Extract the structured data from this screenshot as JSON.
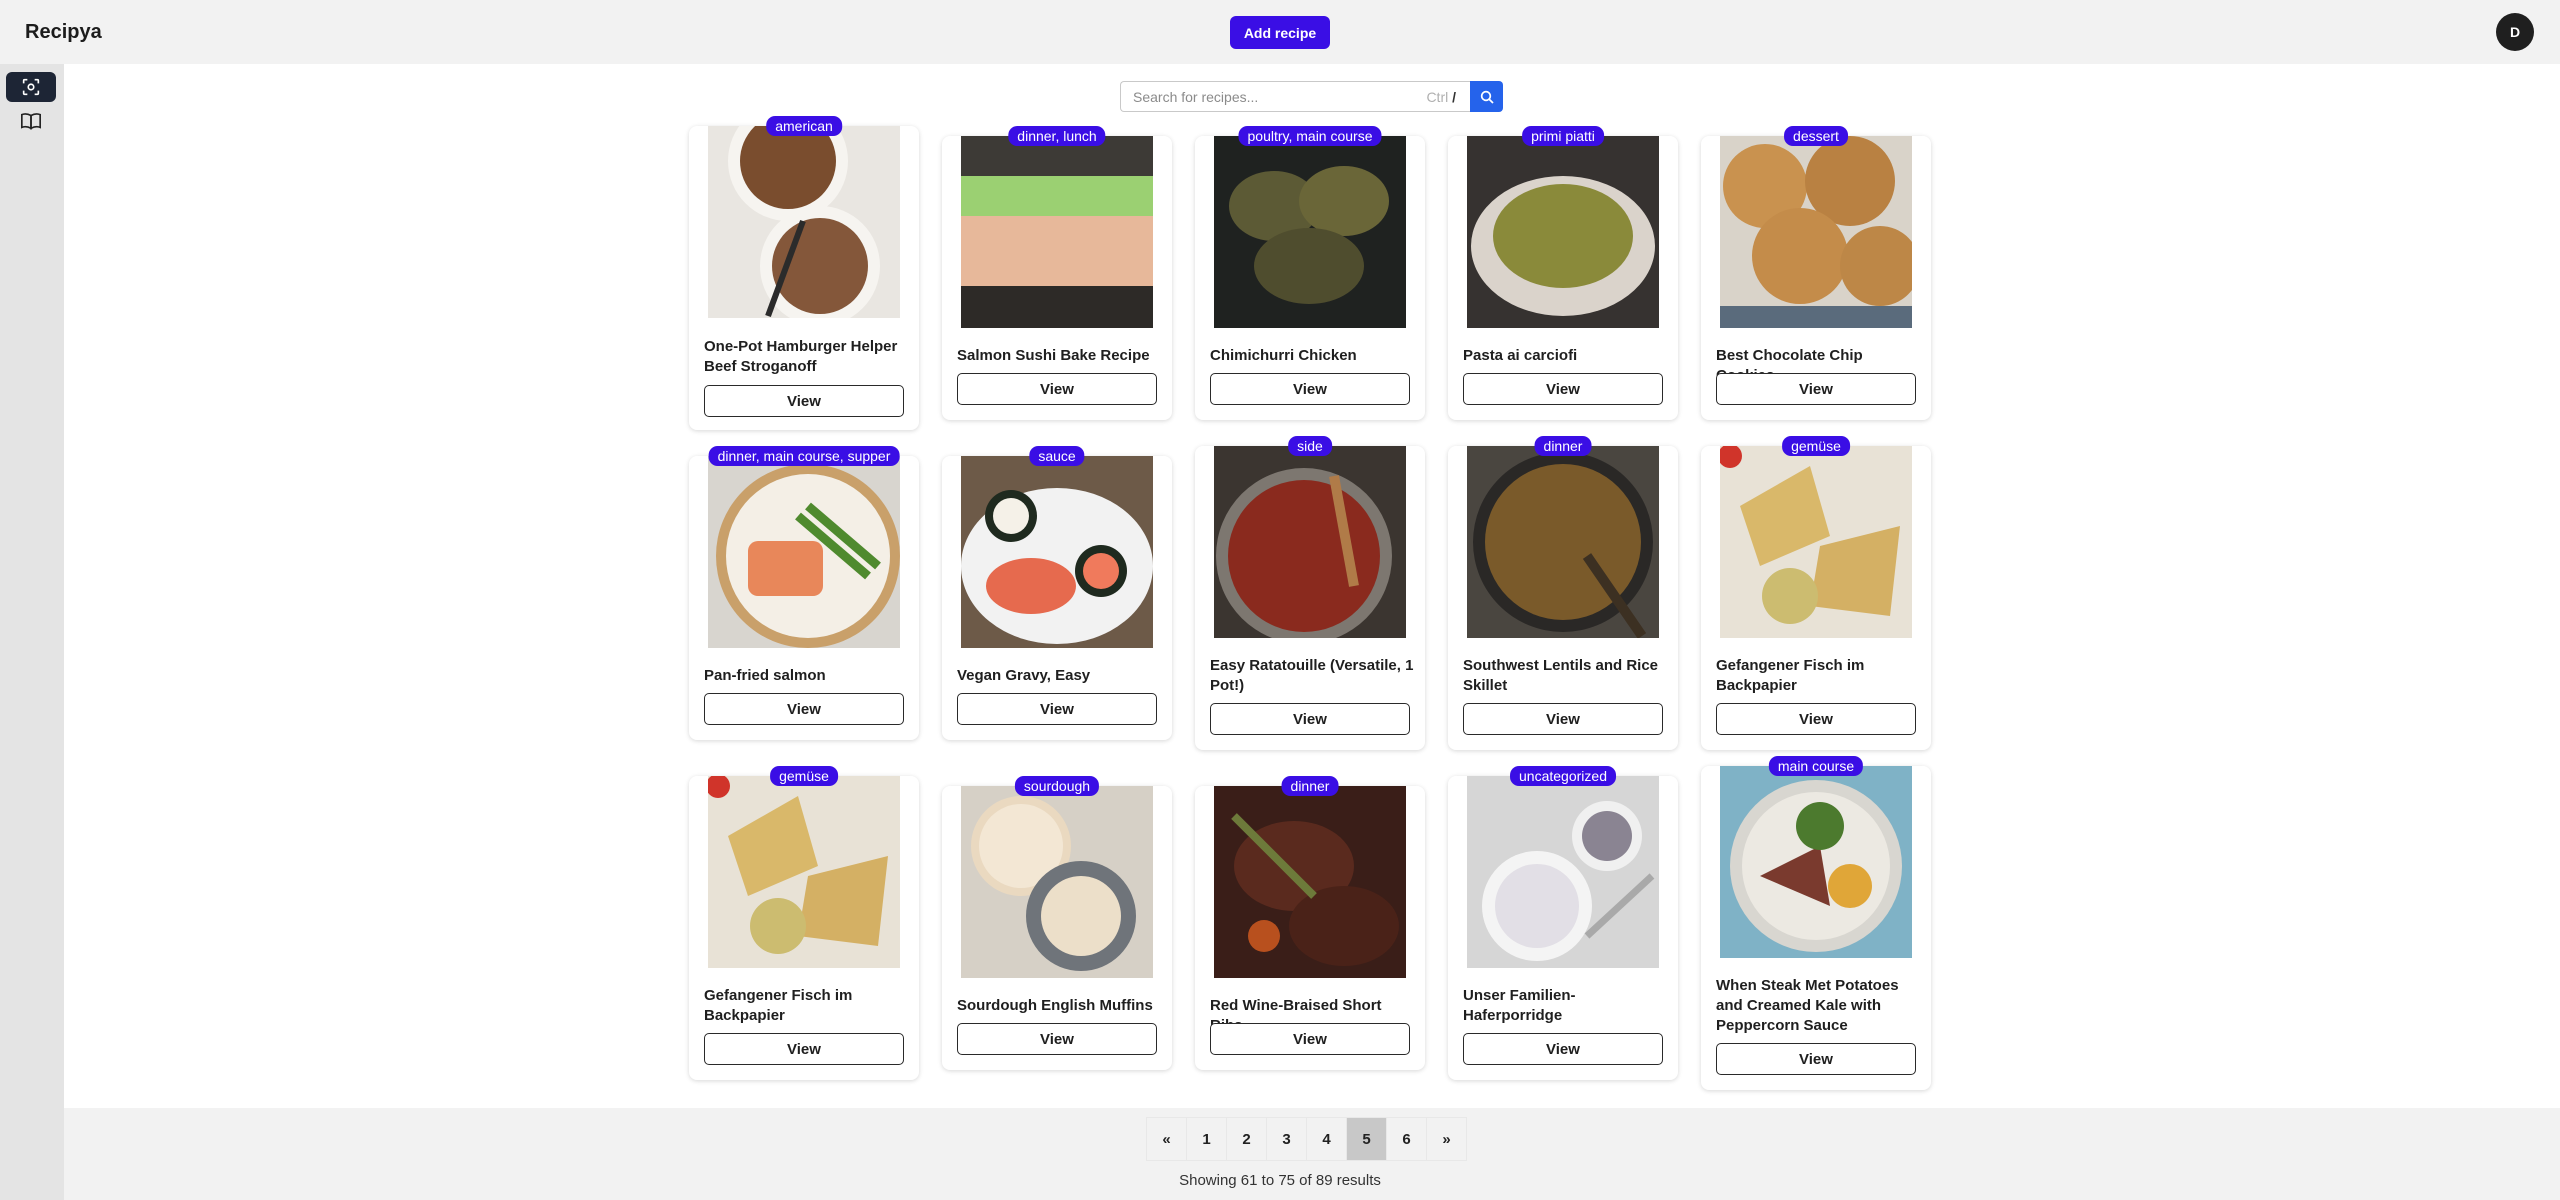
{
  "header": {
    "app_title": "Recipya",
    "add_recipe_label": "Add recipe",
    "avatar_initial": "D"
  },
  "sidebar": {
    "items": [
      {
        "name": "scan-icon",
        "active": true
      },
      {
        "name": "book-icon",
        "active": false
      }
    ]
  },
  "search": {
    "placeholder": "Search for recipes...",
    "shortcut_ctrl": "Ctrl",
    "shortcut_key": "/"
  },
  "colors": {
    "accent": "#3a0ee5",
    "search_button": "#2563eb",
    "sidebar_active": "#1d2535"
  },
  "recipes": [
    {
      "tag": "american",
      "title": "One-Pot Hamburger Helper Beef Stroganoff",
      "view_label": "View"
    },
    {
      "tag": "dinner, lunch",
      "title": "Salmon Sushi Bake Recipe",
      "view_label": "View"
    },
    {
      "tag": "poultry, main course",
      "title": "Chimichurri Chicken",
      "view_label": "View"
    },
    {
      "tag": "primi piatti",
      "title": "Pasta ai carciofi",
      "view_label": "View"
    },
    {
      "tag": "dessert",
      "title": "Best Chocolate Chip Cookies",
      "view_label": "View"
    },
    {
      "tag": "dinner, main course, supper",
      "title": "Pan-fried salmon",
      "view_label": "View"
    },
    {
      "tag": "sauce",
      "title": "Vegan Gravy, Easy",
      "view_label": "View"
    },
    {
      "tag": "side",
      "title": "Easy Ratatouille (Versatile, 1 Pot!)",
      "view_label": "View"
    },
    {
      "tag": "dinner",
      "title": "Southwest Lentils and Rice Skillet",
      "view_label": "View"
    },
    {
      "tag": "gemüse",
      "title": "Gefangener Fisch im Backpapier",
      "view_label": "View"
    },
    {
      "tag": "gemüse",
      "title": "Gefangener Fisch im Backpapier",
      "view_label": "View"
    },
    {
      "tag": "sourdough",
      "title": "Sourdough English Muffins",
      "view_label": "View"
    },
    {
      "tag": "dinner",
      "title": "Red Wine-Braised Short Ribs",
      "view_label": "View"
    },
    {
      "tag": "uncategorized",
      "title": "Unser Familien-Haferporridge",
      "view_label": "View"
    },
    {
      "tag": "main course",
      "title": "When Steak Met Potatoes and Creamed Kale with Peppercorn Sauce",
      "view_label": "View"
    }
  ],
  "pagination": {
    "prev": "«",
    "pages": [
      "1",
      "2",
      "3",
      "4",
      "5",
      "6"
    ],
    "current": "5",
    "next": "»",
    "results_text": "Showing 61 to 75 of 89 results"
  }
}
